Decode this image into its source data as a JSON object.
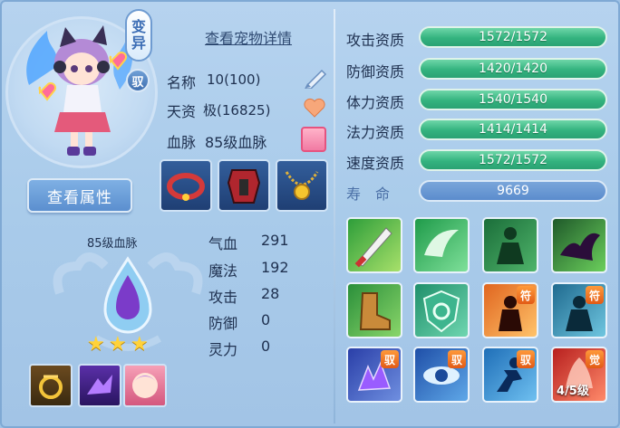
{
  "header": {
    "title": "查看宠物详情"
  },
  "badges": {
    "mutate_line1": "变",
    "mutate_line2": "异",
    "tame": "驭"
  },
  "actions": {
    "view_attributes": "查看属性"
  },
  "info": {
    "name_label": "名称",
    "name_value": "10(100)",
    "talent_label": "天资",
    "talent_value": "极(16825)",
    "blood_label": "血脉",
    "blood_value": "85级血脉"
  },
  "blood_panel": {
    "title": "85级血脉",
    "stars": [
      "★",
      "★",
      "★"
    ]
  },
  "stats": [
    {
      "label": "气血",
      "value": "291"
    },
    {
      "label": "魔法",
      "value": "192"
    },
    {
      "label": "攻击",
      "value": "28"
    },
    {
      "label": "防御",
      "value": "0"
    },
    {
      "label": "灵力",
      "value": "0"
    }
  ],
  "aptitudes": [
    {
      "label": "攻击资质",
      "value": "1572/1572",
      "fill": 1.0
    },
    {
      "label": "防御资质",
      "value": "1420/1420",
      "fill": 1.0
    },
    {
      "label": "体力资质",
      "value": "1540/1540",
      "fill": 1.0
    },
    {
      "label": "法力资质",
      "value": "1414/1414",
      "fill": 1.0
    },
    {
      "label": "速度资质",
      "value": "1572/1572",
      "fill": 1.0
    }
  ],
  "life": {
    "label": "寿　命",
    "value": "9669"
  },
  "skills": {
    "tags": {
      "fu": "符",
      "yu": "驭",
      "jue": "觉"
    },
    "awaken_level": "4/5级"
  },
  "colors": {
    "aptitude_bar": "#34b37f",
    "accent_blue": "#5b8fcf",
    "text_dark": "#1f3150"
  }
}
